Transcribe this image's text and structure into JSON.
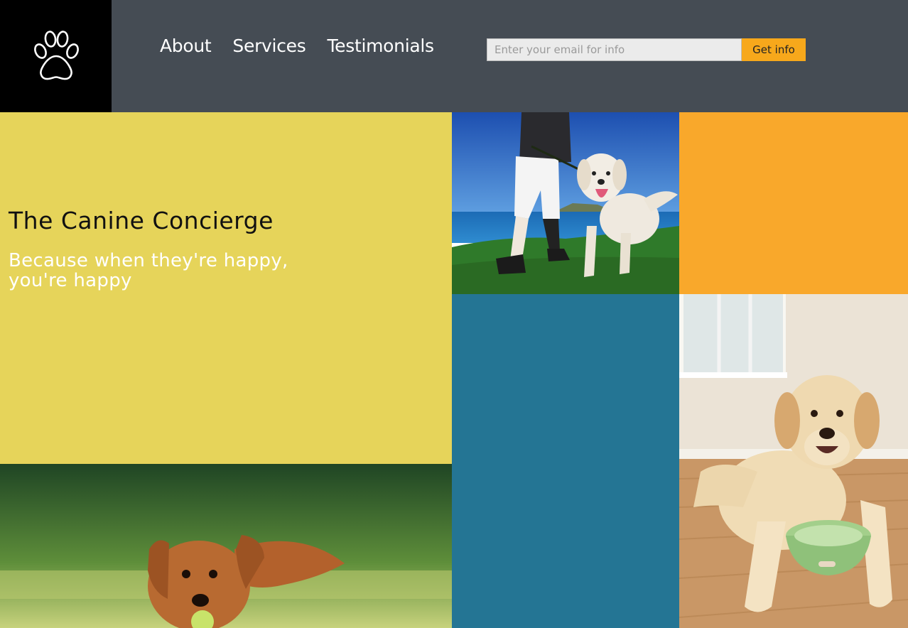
{
  "header": {
    "nav": [
      "About",
      "Services",
      "Testimonials"
    ],
    "email_placeholder": "Enter your email for info",
    "get_info_label": "Get info"
  },
  "hero": {
    "title": "The Canine Concierge",
    "subtitle": "Because when they're happy, you're happy"
  },
  "colors": {
    "header_bg": "#454c54",
    "logo_bg": "#000000",
    "hero_yellow": "#e6d45a",
    "accent_orange": "#f9a82b",
    "teal": "#247594",
    "button_orange": "#f7a81b"
  },
  "icons": {
    "logo": "paw-icon"
  },
  "images": [
    "man-walking-golden-retriever-by-sea",
    "labrador-lying-with-green-food-bowl",
    "golden-retriever-running-with-tennis-ball"
  ]
}
